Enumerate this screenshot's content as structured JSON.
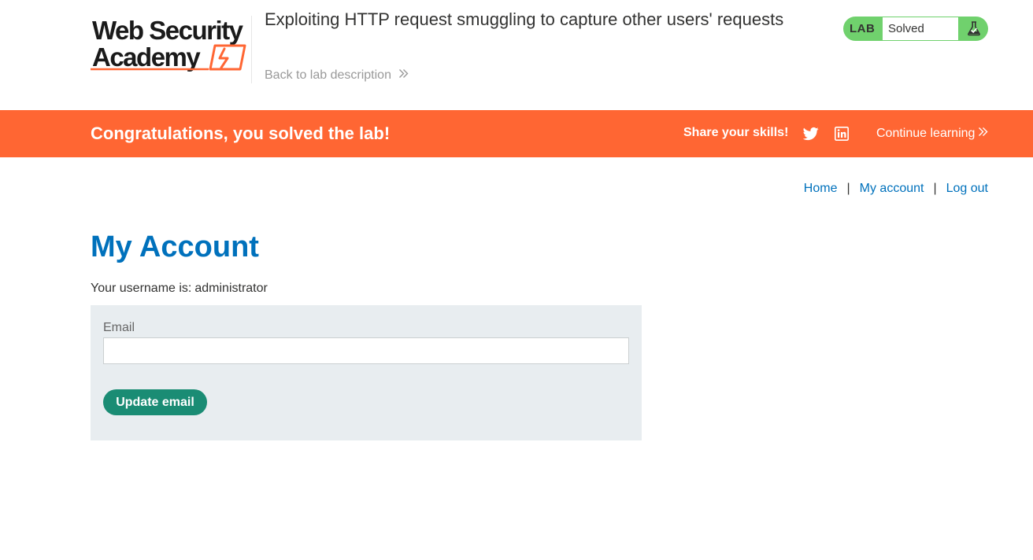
{
  "header": {
    "logo_line1": "Web Security",
    "logo_line2": "Academy",
    "lab_title": "Exploiting HTTP request smuggling to capture other users' requests",
    "back_link": "Back to lab description",
    "lab_label": "LAB",
    "lab_status": "Solved",
    "status_icon": "flask-solved-icon"
  },
  "banner": {
    "message": "Congratulations, you solved the lab!",
    "share_label": "Share your skills!",
    "social_icons": [
      "twitter-icon",
      "linkedin-icon"
    ],
    "continue_link": "Continue learning"
  },
  "nav": {
    "home": "Home",
    "separator": "|",
    "my_account": "My account",
    "log_out": "Log out"
  },
  "main": {
    "title": "My Account",
    "username_prefix": "Your username is:",
    "username": "administrator",
    "email_label": "Email",
    "email_value": "",
    "update_button": "Update email"
  },
  "colors": {
    "brand_orange": "#ff6633",
    "lab_green": "#70d16d",
    "link_blue": "#0071bc",
    "button_teal": "#1a8c74",
    "panel_gray": "#e8edf0"
  }
}
